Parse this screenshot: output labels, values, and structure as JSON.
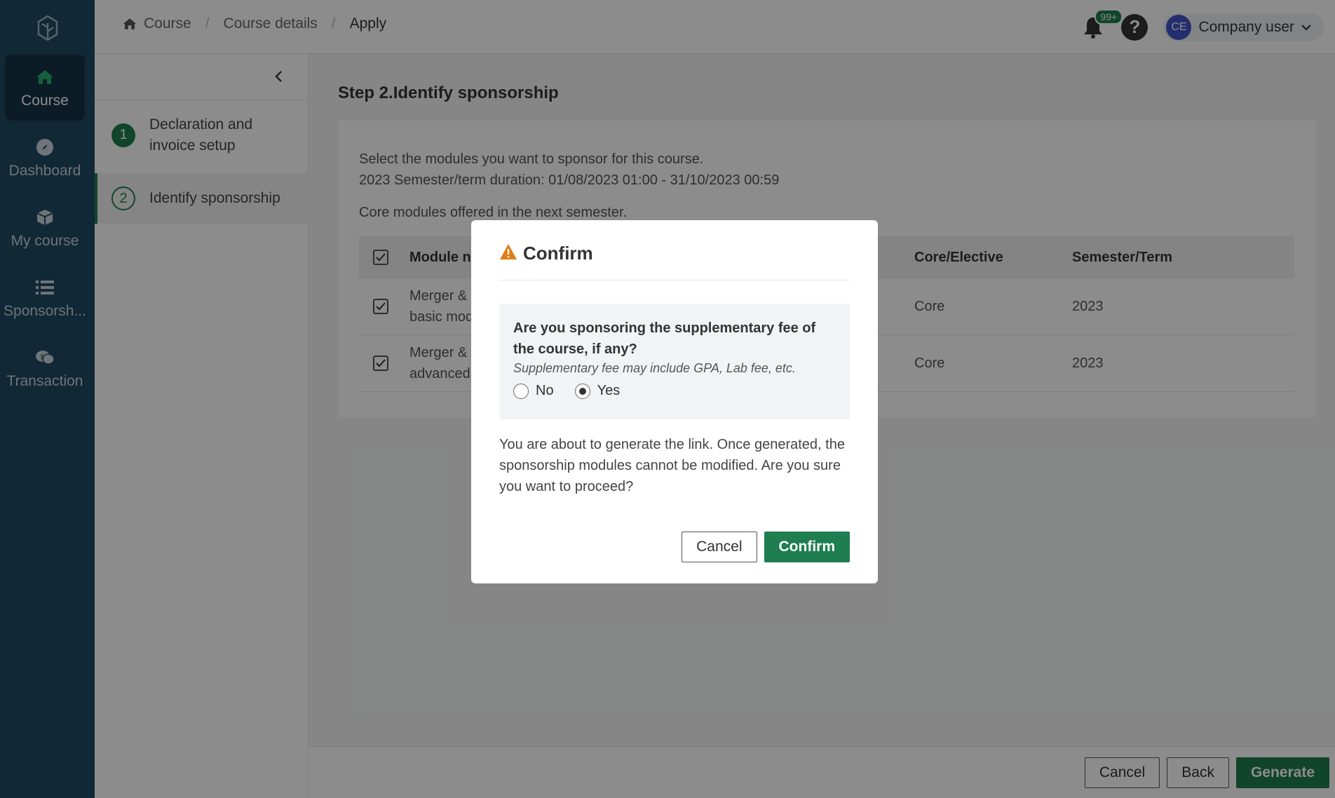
{
  "nav": {
    "items": [
      {
        "label": "Course",
        "icon": "home-icon",
        "active": true
      },
      {
        "label": "Dashboard",
        "icon": "compass-icon",
        "active": false
      },
      {
        "label": "My course",
        "icon": "box-icon",
        "active": false
      },
      {
        "label": "Sponsorsh...",
        "icon": "list-icon",
        "active": false
      },
      {
        "label": "Transaction",
        "icon": "money-chat-icon",
        "active": false
      }
    ]
  },
  "header": {
    "breadcrumb": [
      "Course",
      "Course details",
      "Apply"
    ],
    "notif_count": "99+",
    "user": {
      "initials": "CE",
      "name": "Company user"
    }
  },
  "steps": [
    {
      "num": "1",
      "label": "Declaration and invoice setup"
    },
    {
      "num": "2",
      "label": "Identify sponsorship"
    }
  ],
  "main": {
    "title": "Step 2.Identify sponsorship",
    "desc_line1": "Select the modules you want to sponsor for this course.",
    "desc_line2": "2023 Semester/term duration: 01/08/2023 01:00 - 31/10/2023 00:59",
    "core_label": "Core modules offered in the next semester.",
    "table": {
      "headers": {
        "name": "Module n",
        "core": "Core/Elective",
        "sem": "Semester/Term"
      },
      "rows": [
        {
          "name_l1": "Merger &",
          "name_l2": "basic mod",
          "core": "Core",
          "sem": "2023"
        },
        {
          "name_l1": "Merger &",
          "name_l2": "advanced",
          "core": "Core",
          "sem": "2023"
        }
      ]
    }
  },
  "footer": {
    "cancel": "Cancel",
    "back": "Back",
    "generate": "Generate"
  },
  "modal": {
    "title": "Confirm",
    "question": "Are you sponsoring the supplementary fee of the course, if any?",
    "hint": "Supplementary fee may include GPA, Lab fee, etc.",
    "option_no": "No",
    "option_yes": "Yes",
    "selected": "Yes",
    "message": "You are about to generate the link. Once generated, the sponsorship modules cannot be modified. Are you sure you want to proceed?",
    "cancel": "Cancel",
    "confirm": "Confirm"
  },
  "colors": {
    "nav_bg": "#1f4a63",
    "accent": "#1e7e4f",
    "warning": "#e07b16"
  }
}
